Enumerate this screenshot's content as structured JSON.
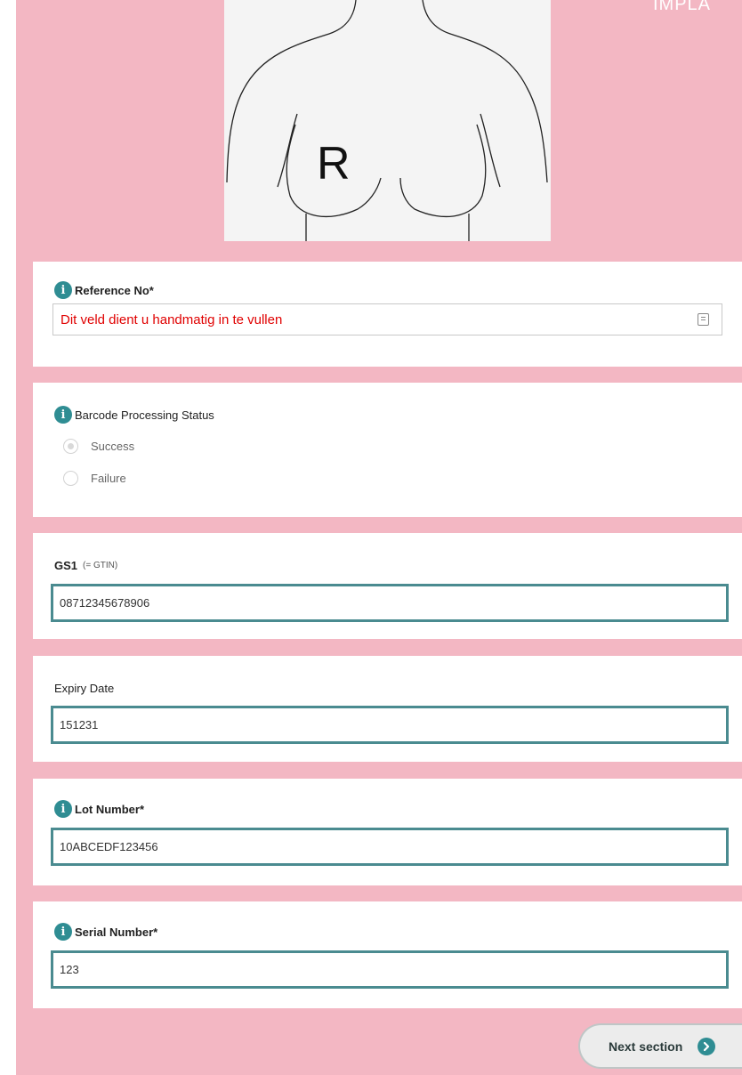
{
  "header": {
    "corner_text": "IMPLA"
  },
  "diagram": {
    "side_letter": "R"
  },
  "reference": {
    "label": "Reference No*",
    "value": "Dit veld dient u handmatig in te vullen"
  },
  "barcode": {
    "label": "Barcode Processing Status",
    "options": [
      "Success",
      "Failure"
    ],
    "selected": "Success"
  },
  "gs1": {
    "label": "GS1",
    "sublabel": "(= GTIN)",
    "value": "08712345678906"
  },
  "expiry": {
    "label": "Expiry Date",
    "value": "151231"
  },
  "lot": {
    "label": "Lot Number*",
    "value": "10ABCEDF123456"
  },
  "serial": {
    "label": "Serial Number*",
    "value": "123"
  },
  "nav": {
    "next_label": "Next section"
  },
  "colors": {
    "page_bg": "#f3b7c3",
    "input_border": "#4a8b90",
    "info_icon": "#2f8d93",
    "placeholder_red": "#e00000"
  },
  "icons": [
    "info-icon",
    "contact-card-icon",
    "chevron-right-icon"
  ]
}
